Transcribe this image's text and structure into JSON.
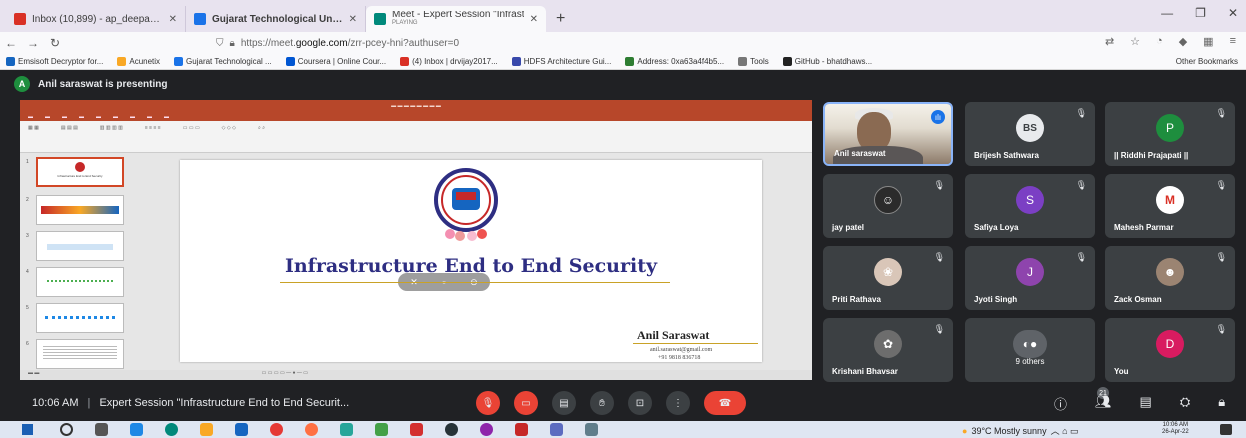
{
  "browser": {
    "tabs": [
      {
        "title": "Inbox (10,899) - ap_deepak@g",
        "color": "#d93025"
      },
      {
        "title": "Gujarat Technological Univers",
        "color": "#1a73e8"
      },
      {
        "title": "Meet - Expert Session \"Infrastr",
        "subtitle": "PLAYING",
        "color": "#00897b"
      }
    ],
    "url_prefix": "https://meet.",
    "url_host": "google.com",
    "url_path": "/zrr-pcey-hni?authuser=0",
    "bookmarks": [
      {
        "label": "Emsisoft Decryptor for...",
        "color": "#1565c0"
      },
      {
        "label": "Acunetix",
        "color": "#f9a825"
      },
      {
        "label": "Gujarat Technological ...",
        "color": "#1a73e8"
      },
      {
        "label": "Coursera | Online Cour...",
        "color": "#0056d2"
      },
      {
        "label": "(4) Inbox | drvijay2017...",
        "color": "#d93025"
      },
      {
        "label": "HDFS Architecture Gui...",
        "color": "#3949ab"
      },
      {
        "label": "Address: 0xa63a4f4b5...",
        "color": "#2e7d32"
      },
      {
        "label": "Tools",
        "color": "#777777"
      },
      {
        "label": "GitHub - bhatdhaws...",
        "color": "#222222"
      }
    ],
    "other_bookmarks": "Other Bookmarks"
  },
  "meet": {
    "presenter_initial": "A",
    "presenter_banner": "Anil saraswat is presenting",
    "slide": {
      "title": "Infrastructure End to End Security",
      "author": "Anil Saraswat",
      "email": "anil.saraswat@gmail.com",
      "phone": "+91 9818 836718",
      "thumb1_title": "Infrastructure End to End Security"
    },
    "participants": [
      {
        "name": "Anil saraswat",
        "type": "video",
        "speaking": true
      },
      {
        "name": "Brijesh Sathwara",
        "initials": "BS",
        "color": "#e8eaed",
        "text": "#3c4043"
      },
      {
        "name": "|| Riddhi Prajapati ||",
        "initials": "P",
        "color": "#1e8e3e",
        "text": "#ffffff"
      },
      {
        "name": "jay patel",
        "initials": "",
        "color": "#2b2b2b",
        "text": "#ffffff"
      },
      {
        "name": "Safiya Loya",
        "initials": "S",
        "color": "#7b3fc4",
        "text": "#ffffff"
      },
      {
        "name": "Mahesh Parmar",
        "initials": "M",
        "color": "#ffffff",
        "text": "#d93025"
      },
      {
        "name": "Priti Rathava",
        "initials": "",
        "color": "#d9c6b8",
        "text": "#ffffff"
      },
      {
        "name": "Jyoti Singh",
        "initials": "J",
        "color": "#8e44ad",
        "text": "#ffffff"
      },
      {
        "name": "Zack Osman",
        "initials": "",
        "color": "#9b8472",
        "text": "#ffffff"
      },
      {
        "name": "Krishani Bhavsar",
        "initials": "",
        "color": "#6d6d6d",
        "text": "#ffffff"
      },
      {
        "name": "9 others",
        "initials": "",
        "color": "#5f6368",
        "text": "#ffffff"
      },
      {
        "name": "You",
        "initials": "D",
        "color": "#d81b60",
        "text": "#ffffff"
      }
    ],
    "time": "10:06 AM",
    "meeting_title": "Expert Session \"Infrastructure End to End Securit...",
    "participant_count": "21"
  },
  "taskbar": {
    "weather": "39°C  Mostly sunny",
    "time": "10:06 AM",
    "date": "26-Apr-22"
  }
}
